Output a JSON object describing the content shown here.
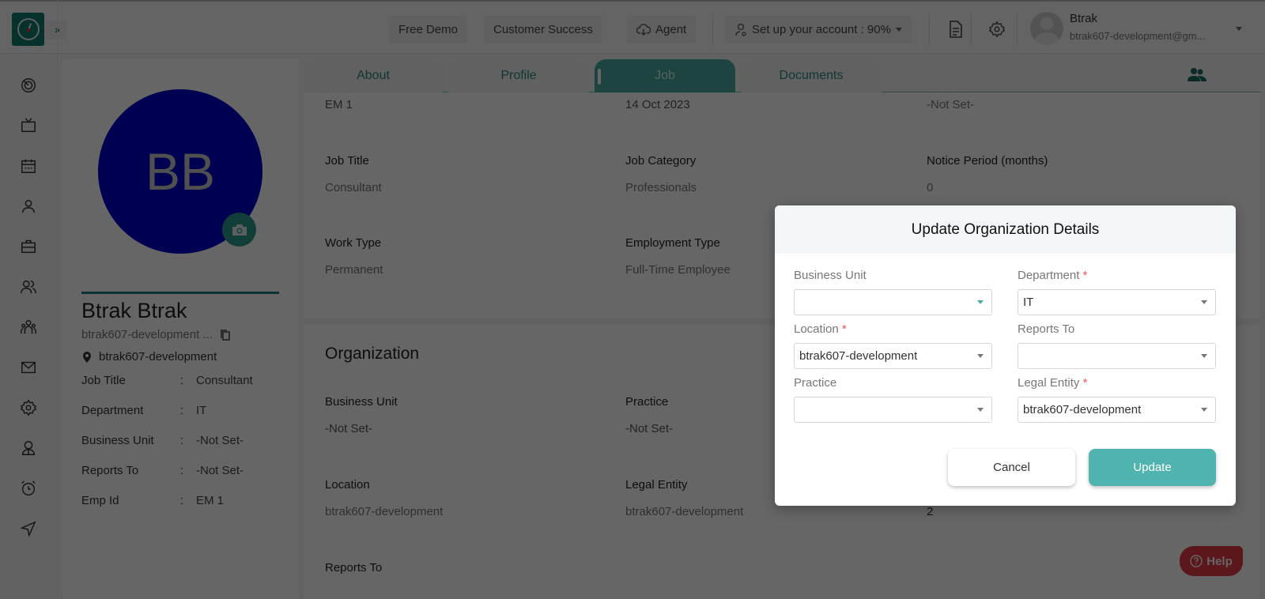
{
  "header": {
    "top_buttons": {
      "free_demo": "Free Demo",
      "customer_success": "Customer Success",
      "agent": "Agent",
      "setup_account": "Set up your account : 90%"
    },
    "user": {
      "name": "Btrak",
      "email": "btrak607-development@gm..."
    }
  },
  "sidebar": {
    "icons": [
      "dashboard-icon",
      "tv-icon",
      "calendar-icon",
      "user-icon",
      "briefcase-icon",
      "users-icon",
      "team-icon",
      "mail-icon",
      "settings-icon",
      "employee-icon",
      "alarm-icon",
      "send-icon"
    ]
  },
  "profile": {
    "initials": "BB",
    "avatar_color": "#0000cc",
    "name": "Btrak Btrak",
    "email": "btrak607-development ...",
    "location": "btrak607-development",
    "info": [
      {
        "key": "Job Title",
        "sep": ":",
        "value": "Consultant"
      },
      {
        "key": "Department",
        "sep": ":",
        "value": "IT"
      },
      {
        "key": "Business Unit",
        "sep": ":",
        "value": "-Not Set-"
      },
      {
        "key": "Reports To",
        "sep": ":",
        "value": "-Not Set-"
      },
      {
        "key": "Emp Id",
        "sep": ":",
        "value": "EM 1"
      }
    ]
  },
  "tabs": [
    {
      "label": "About",
      "active": false
    },
    {
      "label": "Profile",
      "active": false
    },
    {
      "label": "Job",
      "active": true
    },
    {
      "label": "Documents",
      "active": false
    }
  ],
  "job_section": {
    "top_row": [
      "EM 1",
      "14 Oct 2023",
      "-Not Set-"
    ],
    "fields": [
      {
        "label": "Job Title",
        "value": "Consultant"
      },
      {
        "label": "Job Category",
        "value": "Professionals"
      },
      {
        "label": "Notice Period (months)",
        "value": "0"
      },
      {
        "label": "Work Type",
        "value": "Permanent"
      },
      {
        "label": "Employment Type",
        "value": "Full-Time Employee"
      }
    ]
  },
  "organization_section": {
    "title": "Organization",
    "fields": [
      {
        "label": "Business Unit",
        "value": "-Not Set-"
      },
      {
        "label": "Practice",
        "value": "-Not Set-"
      },
      {
        "label": "Location",
        "value": "btrak607-development"
      },
      {
        "label": "Legal Entity",
        "value": "btrak607-development"
      },
      {
        "label": "Reports To",
        "value": ""
      }
    ],
    "extra_value": "2"
  },
  "help": {
    "label": "Help"
  },
  "modal": {
    "title": "Update Organization Details",
    "fields": [
      {
        "label": "Business Unit",
        "required": false,
        "value": ""
      },
      {
        "label": "Department",
        "required": true,
        "value": "IT"
      },
      {
        "label": "Location",
        "required": true,
        "value": "btrak607-development"
      },
      {
        "label": "Reports To",
        "required": false,
        "value": ""
      },
      {
        "label": "Practice",
        "required": false,
        "value": ""
      },
      {
        "label": "Legal Entity",
        "required": true,
        "value": "btrak607-development"
      }
    ],
    "required_mark": "*",
    "cancel_label": "Cancel",
    "update_label": "Update"
  }
}
